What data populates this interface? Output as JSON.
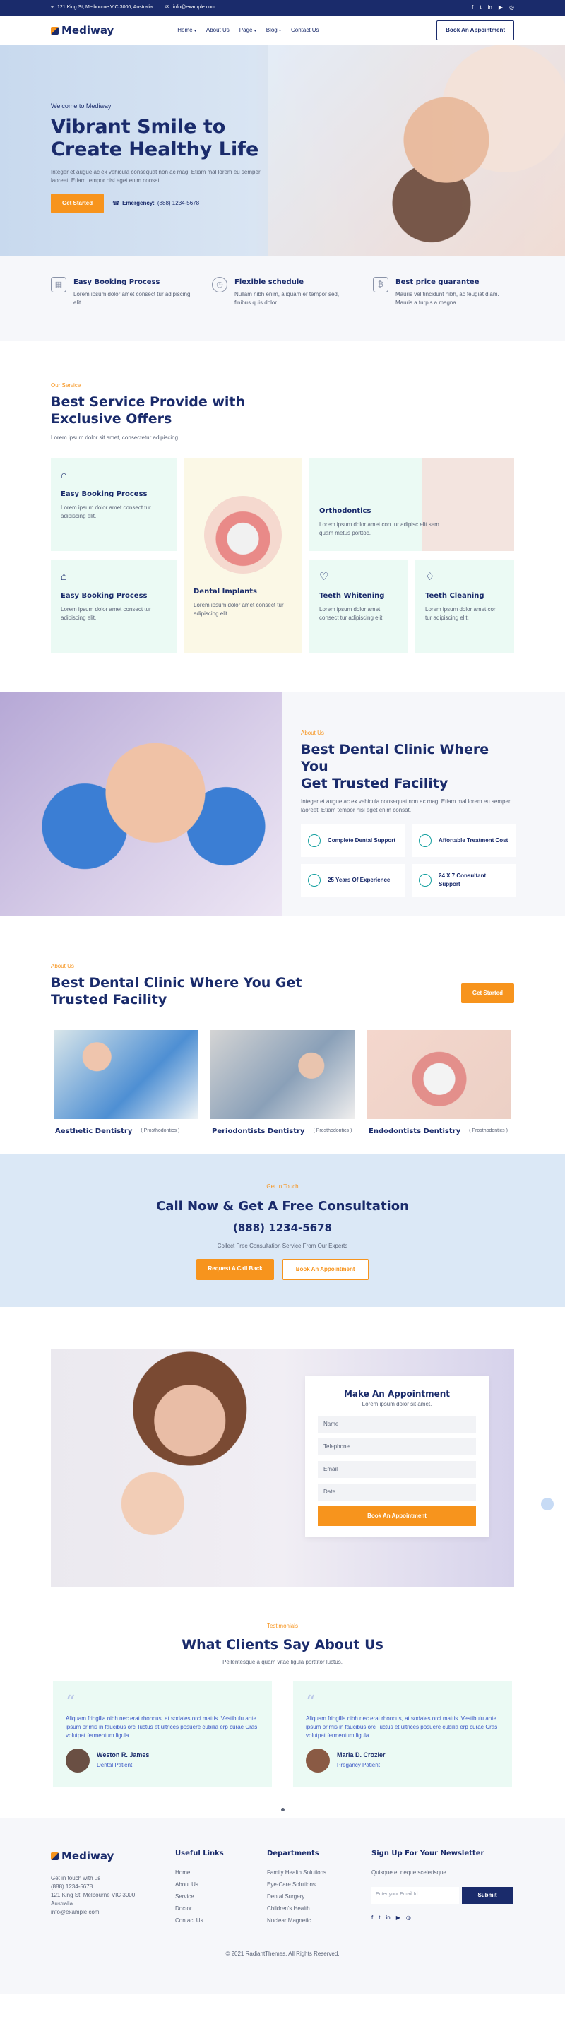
{
  "topbar": {
    "address": "121 King St, Melbourne VIC 3000, Australia",
    "email": "info@example.com",
    "social_icons": [
      "facebook-icon",
      "twitter-icon",
      "linkedin-icon",
      "youtube-icon",
      "instagram-icon"
    ]
  },
  "header": {
    "brand": "Mediway",
    "nav": [
      "Home",
      "About Us",
      "Page",
      "Blog",
      "Contact Us"
    ],
    "cta": "Book An Appointment"
  },
  "hero": {
    "eyebrow": "Welcome to Mediway",
    "title_line1": "Vibrant Smile to",
    "title_line2": "Create Healthy Life",
    "text": "Integer et augue ac ex vehicula consequat non ac mag. Etiam mal lorem eu semper laoreet. Etiam tempor nisl eget enim consat.",
    "button": "Get Started",
    "emergency_label": "Emergency:",
    "emergency_phone": "(888) 1234-5678"
  },
  "features": [
    {
      "icon": "calendar-icon",
      "title": "Easy Booking Process",
      "text": "Lorem ipsum dolor amet consect tur adipiscing elit."
    },
    {
      "icon": "clock-icon",
      "title": "Flexible schedule",
      "text": "Nullam nibh enim, aliquam er tempor sed, finibus quis dolor."
    },
    {
      "icon": "piggy-bank-icon",
      "title": "Best price guarantee",
      "text": "Mauris vel tincidunt nibh, ac feugiat diam. Mauris a turpis a magna."
    }
  ],
  "services": {
    "eyebrow": "Our Service",
    "title_line1": "Best Service Provide with",
    "title_line2": "Exclusive Offers",
    "subtitle": "Lorem ipsum dolor sit amet, consectetur adipiscing.",
    "cards": [
      {
        "title": "Easy Booking Process",
        "text": "Lorem ipsum dolor amet consect tur adipiscing elit."
      },
      {
        "title": "Dental Implants",
        "text": "Lorem ipsum dolor amet consect tur adipiscing elit."
      },
      {
        "title": "Orthodontics",
        "text": "Lorem ipsum dolor amet con tur adipisc elit sem quam metus porttoc."
      },
      {
        "title": "Easy Booking Process",
        "text": "Lorem ipsum dolor amet consect tur adipiscing elit."
      },
      {
        "title": "Teeth Whitening",
        "text": "Lorem ipsum dolor amet consect tur adipiscing elit."
      },
      {
        "title": "Teeth Cleaning",
        "text": "Lorem ipsum dolor amet con tur adipiscing elit."
      }
    ]
  },
  "about": {
    "eyebrow": "About Us",
    "title_line1": "Best Dental Clinic Where You",
    "title_line2": "Get Trusted Facility",
    "text": "Integer et augue ac ex vehicula consequat non ac mag. Etiam mal lorem eu semper laoreet. Etiam tempor nisl eget enim consat.",
    "boxes": [
      "Complete Dental Support",
      "Affortable Treatment Cost",
      "25 Years Of Experience",
      "24 X 7 Consultant Support"
    ]
  },
  "team": {
    "eyebrow": "About Us",
    "title_line1": "Best Dental Clinic Where You Get",
    "title_line2": "Trusted Facility",
    "button": "Get Started",
    "members": [
      {
        "name": "Aesthetic Dentistry",
        "tag": "( Prosthodontics )"
      },
      {
        "name": "Periodontists Dentistry",
        "tag": "( Prosthodontics )"
      },
      {
        "name": "Endodontists Dentistry",
        "tag": "( Prosthodontics )"
      }
    ]
  },
  "cta": {
    "eyebrow": "Get In Touch",
    "title": "Call Now & Get A Free Consultation",
    "phone": "(888) 1234-5678",
    "text": "Collect Free Consultation Service From Our Experts",
    "primary": "Request A Call Back",
    "secondary": "Book An Appointment"
  },
  "appointment": {
    "title": "Make An Appointment",
    "subtitle": "Lorem ipsum dolor sit amet.",
    "fields": [
      "Name",
      "Telephone",
      "Email",
      "Date"
    ],
    "submit": "Book An Appointment"
  },
  "testimonials": {
    "eyebrow": "Testimonials",
    "title": "What Clients Say About Us",
    "subtitle": "Pellentesque a quam vitae ligula porttitor luctus.",
    "items": [
      {
        "text": "Aliquam fringilla nibh nec erat rhoncus, at sodales orci mattis. Vestibulu ante ipsum primis in faucibus orci luctus et ultrices posuere cubilia erp curae Cras volutpat fermentum ligula.",
        "name": "Weston R. James",
        "role": "Dental Patient"
      },
      {
        "text": "Aliquam fringilla nibh nec erat rhoncus, at sodales orci mattis. Vestibulu ante ipsum primis in faucibus orci luctus et ultrices posuere cubilia erp curae Cras volutpat fermentum ligula.",
        "name": "Maria D. Crozier",
        "role": "Pregancy Patient"
      }
    ]
  },
  "footer": {
    "brand": "Mediway",
    "contact_lines": [
      "Get in touch with us",
      "(888) 1234-5678",
      "121 King St, Melbourne VIC 3000, Australia",
      "info@example.com"
    ],
    "useful_links_title": "Useful Links",
    "useful_links": [
      "Home",
      "About Us",
      "Service",
      "Doctor",
      "Contact Us"
    ],
    "departments_title": "Departments",
    "departments": [
      "Family Health Solutions",
      "Eye-Care Solutions",
      "Dental Surgery",
      "Children's Health",
      "Nuclear Magnetic"
    ],
    "newsletter_title": "Sign Up For Your Newsletter",
    "newsletter_text": "Quisque et neque scelerisque.",
    "newsletter_placeholder": "Enter your Email Id",
    "newsletter_button": "Submit",
    "copyright": "© 2021 RadiantThemes. All Rights Reserved."
  }
}
